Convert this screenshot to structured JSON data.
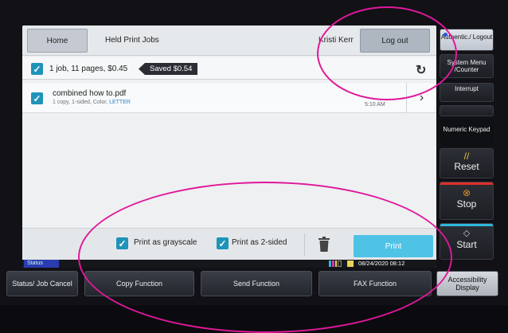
{
  "header": {
    "home_label": "Home",
    "title": "Held Print Jobs",
    "user_name": "Kristi Kerr",
    "logout_label": "Log out"
  },
  "summary": {
    "text": "1 job, 11 pages, $0.45",
    "saved": "Saved $0.54",
    "refresh_icon": "refresh-icon"
  },
  "jobs": [
    {
      "name": "combined how to.pdf",
      "detail": "1 copy, 1-sided, Color, ",
      "paper": "LETTER",
      "time": "5:10 AM"
    }
  ],
  "options": {
    "grayscale_label": "Print as grayscale",
    "two_sided_label": "Print as 2-sided",
    "print_label": "Print"
  },
  "statusbar": {
    "status_label": "Status",
    "datetime": "08/24/2020  08:12"
  },
  "right_keys": {
    "auth": "Authentic./ Logout",
    "system": "System Menu /Counter",
    "interrupt": "Interrupt",
    "numeric": "Numeric Keypad",
    "reset": "Reset",
    "stop": "Stop",
    "start": "Start"
  },
  "bottom_keys": {
    "status": "Status/ Job Cancel",
    "copy": "Copy Function",
    "send": "Send Function",
    "fax": "FAX Function",
    "accessibility": "Accessibility Display"
  },
  "colors": {
    "accent": "#1f93b9",
    "print_button": "#4fc3e6",
    "highlight": "#e0189a"
  }
}
